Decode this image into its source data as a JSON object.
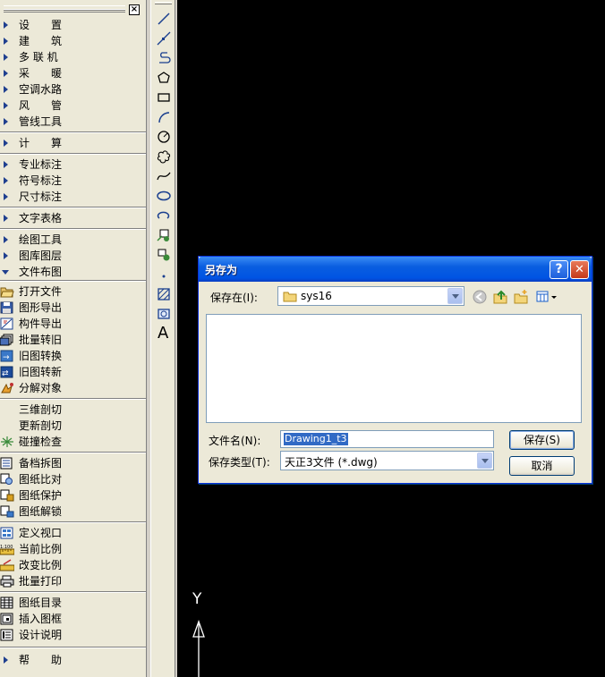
{
  "menu": {
    "close_glyph": "×",
    "groups": [
      [
        "设　　置",
        "建　　筑",
        "多 联 机",
        "采　　暖",
        "空调水路",
        "风　　管",
        "管线工具"
      ],
      [
        "计　　算"
      ],
      [
        "专业标注",
        "符号标注",
        "尺寸标注"
      ],
      [
        "文字表格"
      ],
      [
        "绘图工具",
        "图库图层",
        "文件布图"
      ]
    ],
    "sub_groups": [
      [
        "打开文件",
        "图形导出",
        "构件导出",
        "批量转旧",
        "旧图转换",
        "旧图转新",
        "分解对象"
      ],
      [
        "三维剖切",
        "更新剖切",
        "碰撞检查"
      ],
      [
        "备档拆图",
        "图纸比对",
        "图纸保护",
        "图纸解锁"
      ],
      [
        "定义视口",
        "当前比例",
        "改变比例",
        "批量打印"
      ],
      [
        "图纸目录",
        "插入图框",
        "设计说明"
      ],
      [
        "帮　　助"
      ]
    ]
  },
  "toolbar": {
    "text_tool": "A"
  },
  "canvas": {
    "axis_label": "Y"
  },
  "dialog": {
    "title": "另存为",
    "help_glyph": "?",
    "close_glyph": "✕",
    "save_in_label": "保存在(I):",
    "save_in_value": "sys16",
    "filename_label": "文件名(N):",
    "filename_value": "Drawing1_t3",
    "filetype_label": "保存类型(T):",
    "filetype_value": "天正3文件 (*.dwg)",
    "save_button": "保存(S)",
    "cancel_button": "取消"
  }
}
